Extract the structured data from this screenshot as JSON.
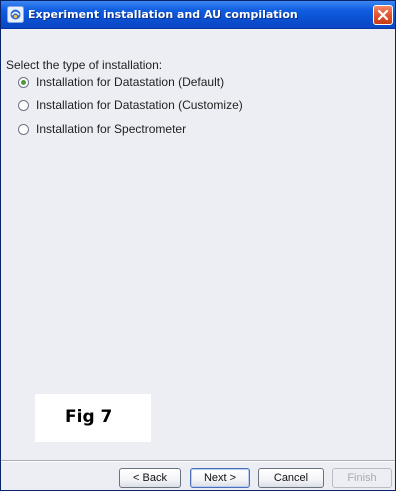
{
  "window": {
    "title": "Experiment installation and AU compilation"
  },
  "content": {
    "prompt": "Select the type of installation:",
    "options": [
      {
        "label": "Installation for Datastation (Default)",
        "checked": true
      },
      {
        "label": "Installation for Datastation (Customize)",
        "checked": false
      },
      {
        "label": "Installation for Spectrometer",
        "checked": false
      }
    ]
  },
  "figure_label": "Fig 7",
  "buttons": {
    "back": "< Back",
    "next": "Next >",
    "cancel": "Cancel",
    "finish": "Finish"
  }
}
